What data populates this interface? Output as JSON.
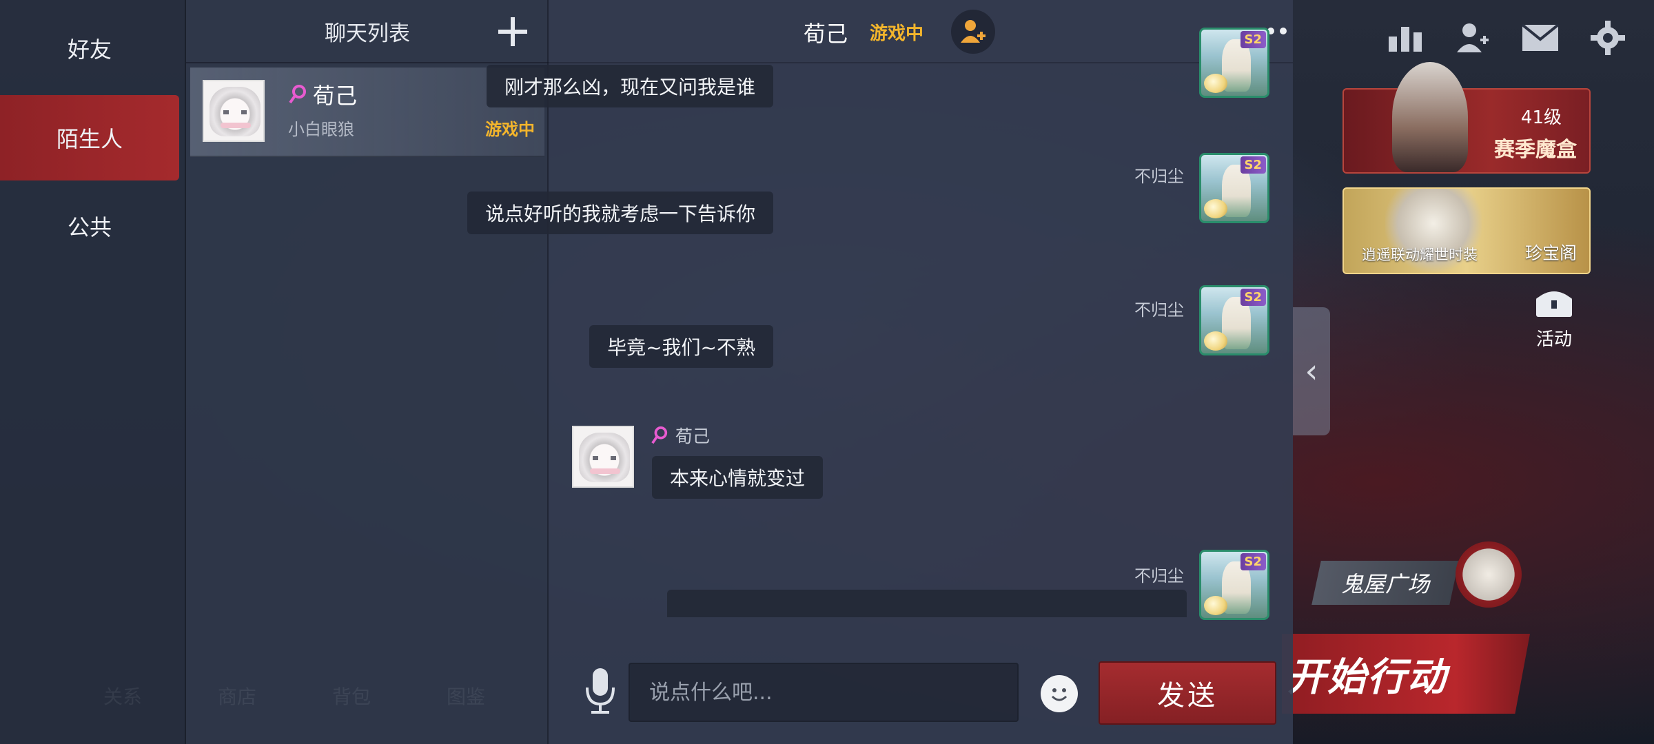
{
  "categories": {
    "friends": "好友",
    "strangers": "陌生人",
    "public": "公共"
  },
  "chat_list": {
    "title": "聊天列表",
    "contacts": [
      {
        "name": "荀己",
        "subtitle": "小白眼狼",
        "status": "游戏中"
      }
    ]
  },
  "chat": {
    "title": "荀己",
    "status": "游戏中",
    "messages": [
      {
        "sender": "",
        "text": "刚才那么凶，现在又问我是谁",
        "self": true
      },
      {
        "sender": "不归尘",
        "text": "说点好听的我就考虑一下告诉你",
        "self": true
      },
      {
        "sender": "不归尘",
        "text": "毕竟~我们~不熟",
        "self": true
      },
      {
        "sender": "荀己",
        "text": "本来心情就变过",
        "self": false
      },
      {
        "sender": "不归尘",
        "text": "",
        "self": true
      }
    ],
    "self_badge": "S2",
    "input_placeholder": "说点什么吧...",
    "send_label": "发送"
  },
  "game": {
    "rank_level": "41级",
    "rank_title": "赛季魔盒",
    "shop_caption": "逍遥联动耀世时装",
    "shop_title": "珍宝阁",
    "activity_label": "活动",
    "ghost_plaza": "鬼屋广场",
    "start_action": "开始行动",
    "bottom_nav": [
      "关系",
      "商店",
      "背包",
      "图鉴"
    ]
  },
  "colors": {
    "accent_red": "#a52a2d",
    "status_yellow": "#f3b52c",
    "gender_pink": "#e85bd0"
  }
}
